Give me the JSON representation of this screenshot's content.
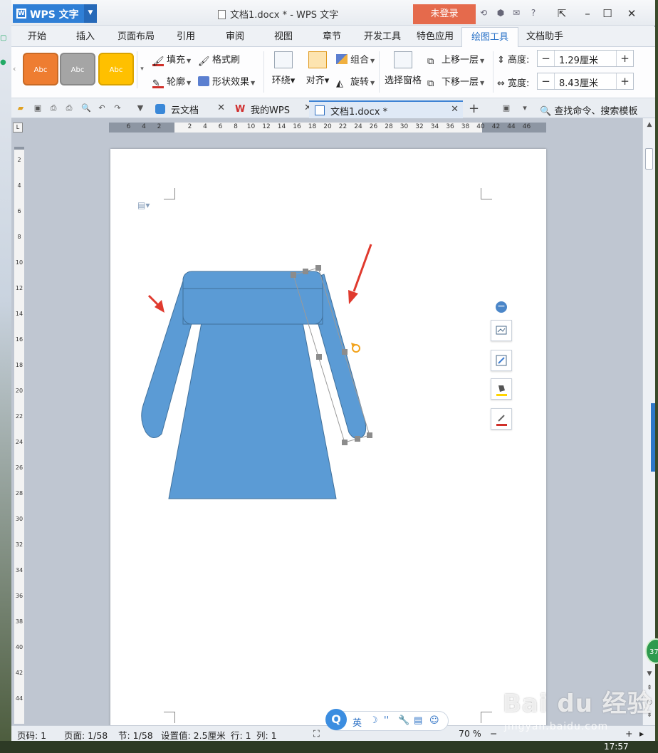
{
  "title_bar": {
    "app_name": "WPS 文字",
    "document_title": "文档1.docx * - WPS 文字",
    "login_button": "未登录"
  },
  "menu_tabs": [
    "开始",
    "插入",
    "页面布局",
    "引用",
    "审阅",
    "视图",
    "章节",
    "开发工具",
    "特色应用",
    "绘图工具",
    "文档助手"
  ],
  "active_tab": "绘图工具",
  "ribbon": {
    "style_swatches": [
      {
        "label": "Abc",
        "color": "#ee7d31"
      },
      {
        "label": "Abc",
        "color": "#a5a5a5"
      },
      {
        "label": "Abc",
        "color": "#ffc000"
      }
    ],
    "fill": "填充",
    "format_painter": "格式刷",
    "outline": "轮廓",
    "shape_effect": "形状效果",
    "wrap": "环绕",
    "align": "对齐",
    "group": "组合",
    "rotate": "旋转",
    "selection_pane": "选择窗格",
    "bring_forward": "上移一层",
    "send_backward": "下移一层",
    "height_label": "高度:",
    "height_value": "1.29厘米",
    "width_label": "宽度:",
    "width_value": "8.43厘米"
  },
  "doc_tabs": [
    {
      "label": "云文档",
      "active": false
    },
    {
      "label": "我的WPS",
      "active": false
    },
    {
      "label": "文档1.docx *",
      "active": true
    }
  ],
  "search_command": "查找命令、搜索模板",
  "ruler": {
    "horizontal_ticks": [
      "6",
      "4",
      "2",
      "2",
      "4",
      "6",
      "8",
      "10",
      "12",
      "14",
      "16",
      "18",
      "20",
      "22",
      "24",
      "26",
      "28",
      "30",
      "32",
      "34",
      "36",
      "38",
      "40",
      "42",
      "44",
      "46"
    ],
    "vertical_ticks": [
      "2",
      "4",
      "6",
      "8",
      "10",
      "12",
      "14",
      "16",
      "18",
      "20",
      "22",
      "24",
      "26",
      "28",
      "30",
      "32",
      "34",
      "36",
      "38",
      "40",
      "42",
      "44"
    ]
  },
  "drawing": {
    "shape_fill": "#5b9bd5",
    "shape_outline": "#41719c",
    "arrow_color": "#e03a2e",
    "handle_color": "#8c8c8c",
    "rotate_handle_color": "#f2a21a"
  },
  "status_bar": {
    "page": "页码: 1",
    "pages": "页面: 1/58",
    "section": "节: 1/58",
    "setting": "设置值: 2.5厘米",
    "row": "行: 1",
    "col": "列: 1",
    "zoom": "70 %"
  },
  "ime": {
    "lang": "英"
  },
  "clock": "17:57",
  "watermark": {
    "brand": "Bai du 经验",
    "url": "jingyan.baidu.com"
  }
}
